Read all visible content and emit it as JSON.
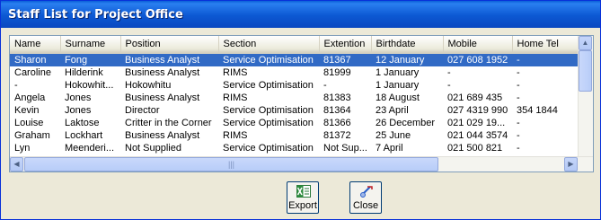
{
  "window": {
    "title": "Staff List for Project Office"
  },
  "columns": [
    "Name",
    "Surname",
    "Position",
    "Section",
    "Extention",
    "Birthdate",
    "Mobile",
    "Home Tel"
  ],
  "rows": [
    [
      "Sharon",
      "Fong",
      "Business Analyst",
      "Service Optimisation",
      "81367",
      "12 January",
      "027 608 1952",
      "-"
    ],
    [
      "Caroline",
      "Hilderink",
      "Business Analyst",
      "RIMS",
      "81999",
      "1 January",
      "-",
      "-"
    ],
    [
      "-",
      "Hokowhit...",
      "Hokowhitu",
      "Service Optimisation",
      "-",
      "1 January",
      "-",
      "-"
    ],
    [
      "Angela",
      "Jones",
      "Business Analyst",
      "RIMS",
      "81383",
      "18 August",
      "021 689 435",
      "-"
    ],
    [
      "Kevin",
      "Jones",
      "Director",
      "Service Optimisation",
      "81364",
      "23 April",
      "027 4319 990",
      "354 1844"
    ],
    [
      "Louise",
      "Laktose",
      "Critter in the Corner",
      "Service Optimisation",
      "81366",
      "26 December",
      "021 029 19...",
      "-"
    ],
    [
      "Graham",
      "Lockhart",
      "Business Analyst",
      "RIMS",
      "81372",
      "25 June",
      "021 044 3574",
      "-"
    ],
    [
      "Lyn",
      "Meenderi...",
      "Not Supplied",
      "Service Optimisation",
      "Not Sup...",
      "7 April",
      "021 500 821",
      "-"
    ]
  ],
  "selected_row": 0,
  "buttons": {
    "export_label": "Export",
    "close_label": "Close"
  },
  "colors": {
    "selection": "#316ac5",
    "titlebar": "#0a5fd8"
  }
}
